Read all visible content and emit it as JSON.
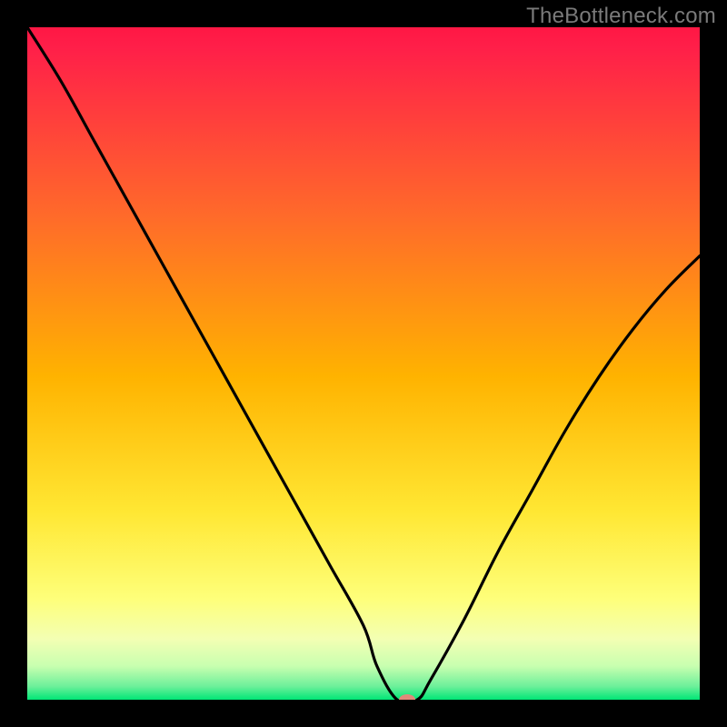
{
  "watermark": "TheBottleneck.com",
  "chart_data": {
    "type": "line",
    "title": "",
    "xlabel": "",
    "ylabel": "",
    "legend": false,
    "grid": false,
    "xlim": [
      0,
      100
    ],
    "ylim": [
      0,
      100
    ],
    "background_gradient": [
      "#ff1744",
      "#ff9800",
      "#ffeb3b",
      "#ffff8d",
      "#00e676"
    ],
    "series": [
      {
        "name": "curve",
        "x": [
          0,
          5,
          10,
          15,
          20,
          25,
          30,
          35,
          40,
          45,
          50,
          52,
          55,
          58,
          60,
          65,
          70,
          75,
          80,
          85,
          90,
          95,
          100
        ],
        "y": [
          100,
          92,
          83,
          74,
          65,
          56,
          47,
          38,
          29,
          20,
          11,
          5,
          0,
          0,
          3,
          12,
          22,
          31,
          40,
          48,
          55,
          61,
          66
        ]
      }
    ],
    "marker": {
      "x": 56.5,
      "y": 0,
      "color": "#e08a7a",
      "rx": 9,
      "ry": 6
    }
  }
}
